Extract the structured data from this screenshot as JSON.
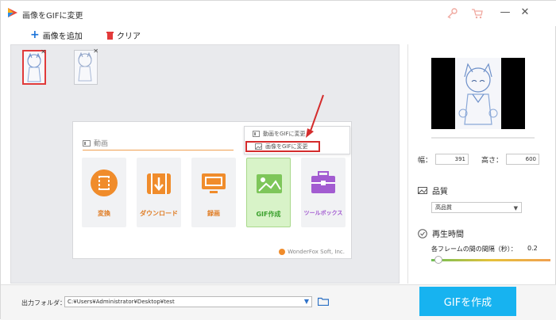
{
  "window": {
    "title": "画像をGIFに変更"
  },
  "toolbar": {
    "add_label": "画像を追加",
    "clear_label": "クリア"
  },
  "launcher": {
    "section_title": "動画",
    "tiles": [
      {
        "label": "変換"
      },
      {
        "label": "ダウンロード"
      },
      {
        "label": "録画"
      },
      {
        "label": "GIF作成"
      },
      {
        "label": "ツールボックス"
      }
    ],
    "brand": "WonderFox Soft, Inc."
  },
  "popup": {
    "items": [
      {
        "label": "動画をGIFに変更"
      },
      {
        "label": "画像をGIFに変更"
      }
    ]
  },
  "settings": {
    "width_label": "幅：",
    "width_value": "391",
    "height_label": "高さ：",
    "height_value": "600",
    "quality_title": "品質",
    "quality_value": "高品質",
    "playback_title": "再生時間",
    "frame_label": "各フレームの間の間隔（秒）：",
    "frame_value": "0.2",
    "frame_slider_fraction": 0.06
  },
  "bottom": {
    "output_label": "出力フォルダ：",
    "output_path": "C:¥Users¥Administrator¥Desktop¥test",
    "make_button": "GIFを作成"
  },
  "colors": {
    "accent": "#17b3f0",
    "highlight": "#d42c2c",
    "orange": "#e07d25",
    "green": "#3aa02c"
  }
}
